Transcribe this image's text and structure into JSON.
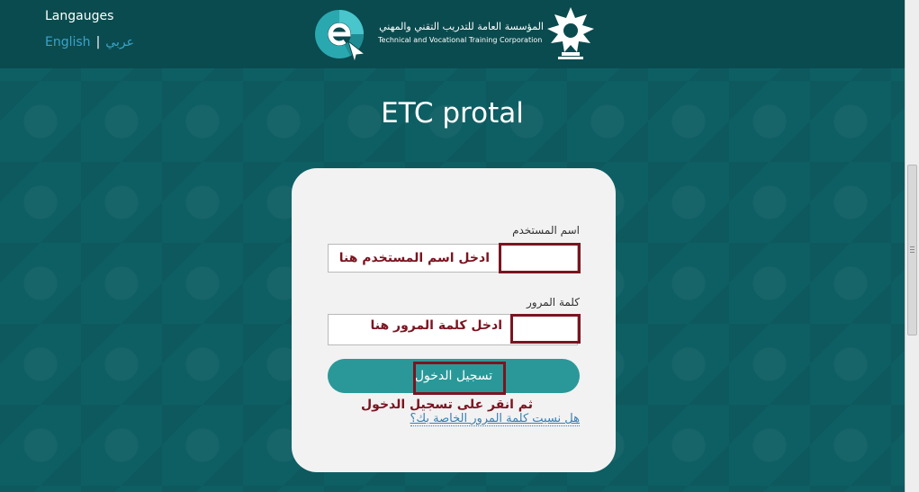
{
  "header": {
    "languages_title": "Langauges",
    "lang_english": "English",
    "lang_separator": "|",
    "lang_arabic": "عربي",
    "org_name_ar": "المؤسسة العامة للتدريب التقني والمهني",
    "org_name_en": "Technical and Vocational Training Corporation"
  },
  "main": {
    "title": "ETC protal"
  },
  "login": {
    "username_label": "اسم المستخدم",
    "username_hint": "ادخل اسم المستخدم هنا",
    "password_label": "كلمة المرور",
    "password_hint": "ادخل كلمة المرور هنا",
    "login_button": "تسجيل الدخول",
    "login_hint": "ثم انقر على تسجيل الدخول",
    "forgot_link": "هل نسيت كلمة المرور الخاصة بك؟"
  },
  "colors": {
    "header_bg": "#0a4b4f",
    "page_bg": "#0e5f64",
    "button": "#2a9898",
    "annotation": "#7b1420",
    "link": "#3ba3c9"
  },
  "icons": {
    "logo": "e-portal-logo-icon",
    "emblem": "tvtc-emblem-icon"
  }
}
